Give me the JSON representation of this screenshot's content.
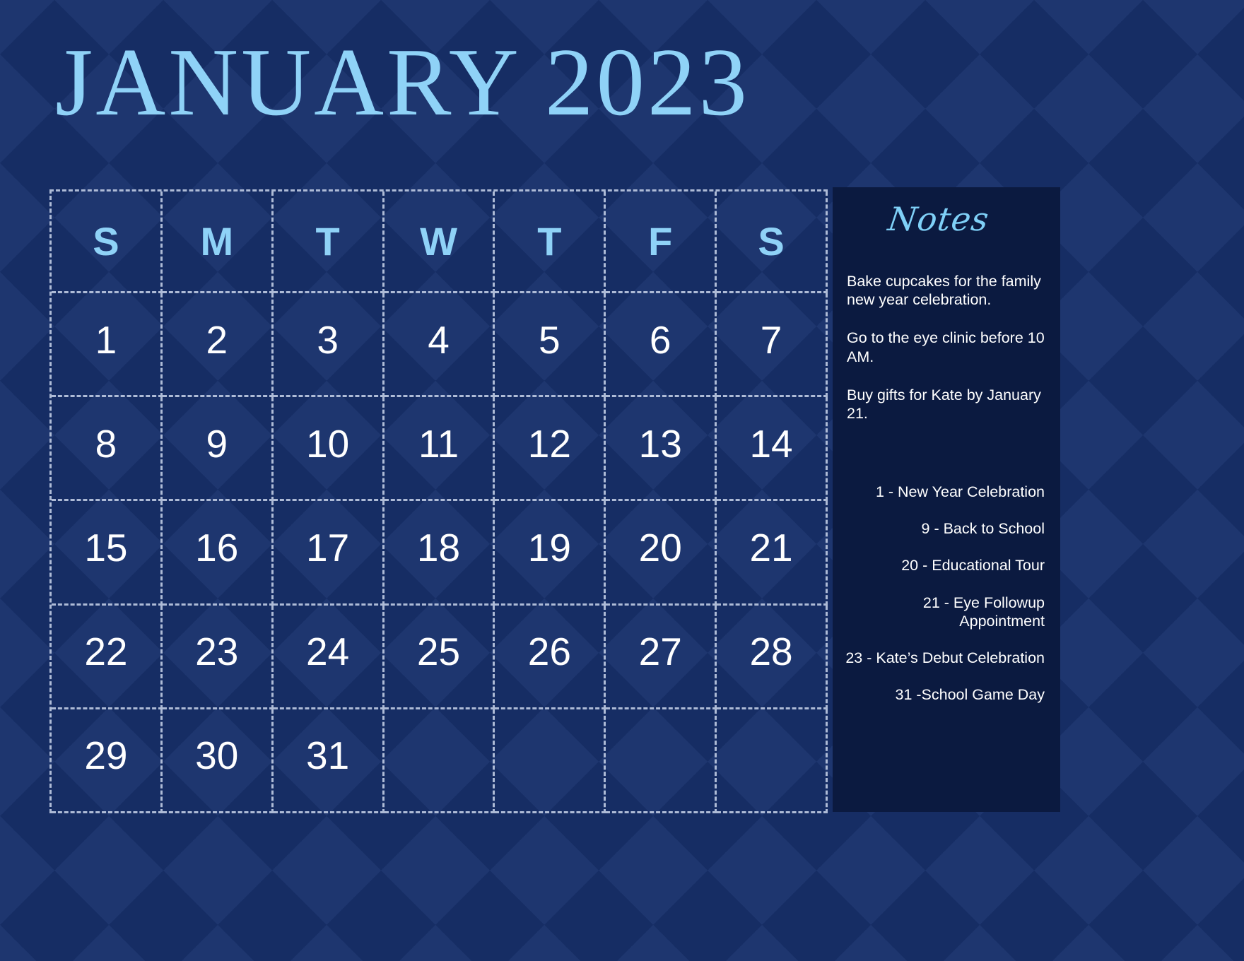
{
  "theme": {
    "background_navy": "#17306a",
    "panel_navy": "#0b1a40",
    "accent_light_blue": "#8fd2f7",
    "grid_line": "#aebbd6",
    "text_white": "#ffffff"
  },
  "header": {
    "title": "JANUARY 2023",
    "month": "JANUARY",
    "year": "2023"
  },
  "calendar": {
    "weekday_headers": [
      "S",
      "M",
      "T",
      "W",
      "T",
      "F",
      "S"
    ],
    "weeks": [
      [
        "1",
        "2",
        "3",
        "4",
        "5",
        "6",
        "7"
      ],
      [
        "8",
        "9",
        "10",
        "11",
        "12",
        "13",
        "14"
      ],
      [
        "15",
        "16",
        "17",
        "18",
        "19",
        "20",
        "21"
      ],
      [
        "22",
        "23",
        "24",
        "25",
        "26",
        "27",
        "28"
      ],
      [
        "29",
        "30",
        "31",
        "",
        "",
        "",
        ""
      ]
    ]
  },
  "notes": {
    "heading": "Notes",
    "paragraphs": [
      "Bake cupcakes for the family new year celebration.",
      "Go to the eye clinic before 10 AM.",
      "Buy gifts for Kate by January 21."
    ],
    "events": [
      "1 - New Year Celebration",
      "9 - Back to School",
      "20 - Educational Tour",
      "21 - Eye Followup Appointment",
      "23 - Kate’s Debut Celebration",
      "31 -School Game Day"
    ]
  }
}
